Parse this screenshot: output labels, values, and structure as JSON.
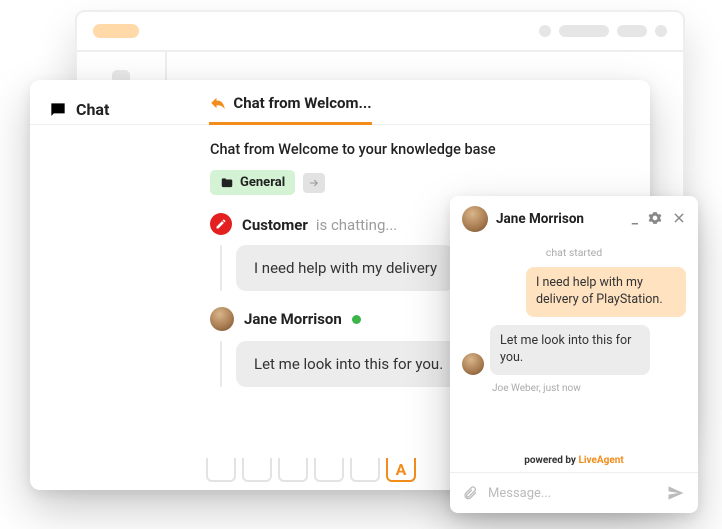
{
  "panel": {
    "section_title": "Chat",
    "tab_title": "Chat from Welcom...",
    "subject": "Chat from Welcome to your knowledge base",
    "tag": {
      "label": "General"
    },
    "customer_label": "Customer",
    "is_chatting_text": "is chatting...",
    "agent_name": "Jane Morrison",
    "messages": {
      "customer": "I need help with my delivery",
      "agent": "Let me look into this for you."
    },
    "active_tool_letter": "A"
  },
  "widget": {
    "agent_name": "Jane Morrison",
    "chat_started_label": "chat started",
    "user_message": "I need help with my delivery of PlayStation.",
    "agent_message": "Let me look into this for you.",
    "meta_author": "Joe Weber, just now",
    "powered_prefix": "powered by ",
    "powered_brand": "LiveAgent",
    "input_placeholder": "Message..."
  },
  "colors": {
    "accent": "#f28c1a",
    "tag_bg": "#d4f3d4",
    "danger": "#e41f1f",
    "online": "#3bb54a"
  }
}
